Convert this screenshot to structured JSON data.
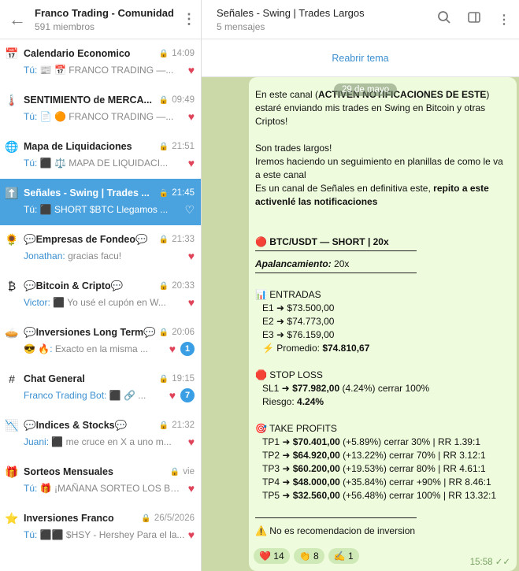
{
  "left": {
    "title": "Franco Trading - Comunidad",
    "subtitle": "591 miembros",
    "chats": [
      {
        "icon": "📅",
        "name": "Calendario Economico",
        "time": "14:09",
        "sender": "Tú:",
        "preview": "📰 📅 FRANCO TRADING —...",
        "badge": ""
      },
      {
        "icon": "🌡️",
        "name": "SENTIMIENTO de MERCA...",
        "time": "09:49",
        "sender": "Tú:",
        "preview": "📄 🟠 FRANCO TRADING —...",
        "badge": ""
      },
      {
        "icon": "🌐",
        "name": "Mapa de Liquidaciones",
        "time": "21:51",
        "sender": "Tú:",
        "preview": "⬛ ⚖️ MAPA DE LIQUIDACI...",
        "badge": ""
      },
      {
        "icon": "⬆️",
        "name": "Señales - Swing | Trades ...",
        "time": "21:45",
        "sender": "Tú:",
        "preview": "⬛ SHORT $BTC  Llegamos ...",
        "badge": ""
      },
      {
        "icon": "🌻",
        "name": "💬Empresas de Fondeo💬",
        "time": "21:33",
        "sender": "Jonathan:",
        "preview": "gracias facu!",
        "badge": ""
      },
      {
        "icon": "₿",
        "name": "💬Bitcoin & Cripto💬",
        "time": "20:33",
        "sender": "Victor:",
        "preview": "⬛ Yo usé el cupón en W...",
        "badge": ""
      },
      {
        "icon": "🥧",
        "name": "💬Inversiones Long Term💬",
        "time": "20:06",
        "sender": "😎 🔥:",
        "preview": "Exacto en la misma ...",
        "badge": "1"
      },
      {
        "icon": "#",
        "name": "Chat General",
        "time": "19:15",
        "sender": "Franco Trading Bot:",
        "preview": "⬛ 🔗 ...",
        "badge": "7"
      },
      {
        "icon": "📉",
        "name": "💬Indices & Stocks💬",
        "time": "21:32",
        "sender": "Juani:",
        "preview": "⬛ me cruce en X a uno m...",
        "badge": ""
      },
      {
        "icon": "🎁",
        "name": "Sorteos Mensuales",
        "time": "vie",
        "sender": "Tú:",
        "preview": "🎁 ¡MAÑANA SORTEO LOS BON...",
        "badge": ""
      },
      {
        "icon": "⭐",
        "name": "Inversiones Franco",
        "time": "26/5/2026",
        "sender": "Tú:",
        "preview": "⬛⬛ $HSY - Hershey  Para el la...",
        "badge": ""
      }
    ]
  },
  "right": {
    "title": "Señales - Swing | Trades Largos",
    "subtitle": "5 mensajes",
    "reopen": "Reabrir tema",
    "date": "29 de mayo",
    "msg": {
      "l1a": "En este canal (",
      "l1b": "ACTIVEN NOTIFICACIONES DE ESTE",
      "l1c": ") estaré enviando mis trades en Swing en Bitcoin y otras Criptos!",
      "l2": "Son trades largos!",
      "l3": "Iremos haciendo un seguimiento en planillas de como le va a este canal",
      "l4a": "Es un canal de Señales en definitiva este, ",
      "l4b": "repito a este activenlé las notificaciones",
      "pair": "🔴 BTC/USDT — SHORT  |  20x",
      "lev_label": "Apalancamiento:",
      "lev_val": " 20x",
      "entries_h": "📊 ENTRADAS",
      "e1": "E1 ➜ $73.500,00",
      "e2": "E2 ➜ $74.773,00",
      "e3": "E3 ➜ $76.159,00",
      "avg_label": "⚡ Promedio: ",
      "avg_val": "$74.810,67",
      "sl_h": "🛑 STOP LOSS",
      "sl1a": "SL1 ➜ ",
      "sl1b": "$77.982,00",
      "sl1c": "  (4.24%)  cerrar 100%",
      "risk_a": "Riesgo: ",
      "risk_b": "4.24%",
      "tp_h": "🎯 TAKE PROFITS",
      "tps": [
        {
          "a": "TP1 ➜ ",
          "b": "$70.401,00",
          "c": "  (+5.89%)  cerrar 30% | RR 1.39:1"
        },
        {
          "a": "TP2 ➜ ",
          "b": "$64.920,00",
          "c": "  (+13.22%)  cerrar 70% | RR 3.12:1"
        },
        {
          "a": "TP3 ➜ ",
          "b": "$60.200,00",
          "c": "  (+19.53%)  cerrar 80% | RR 4.61:1"
        },
        {
          "a": "TP4 ➜ ",
          "b": "$48.000,00",
          "c": "  (+35.84%)  cerrar +90% | RR 8.46:1"
        },
        {
          "a": "TP5 ➜ ",
          "b": "$32.560,00",
          "c": "  (+56.48%)  cerrar 100%  |  RR 13.32:1"
        }
      ],
      "warn": "⚠️ No es recomendacion de inversion",
      "time": "15:58"
    },
    "reactions": [
      {
        "emoji": "❤️",
        "count": "14"
      },
      {
        "emoji": "👏",
        "count": "8"
      },
      {
        "emoji": "✍️",
        "count": "1"
      }
    ]
  }
}
